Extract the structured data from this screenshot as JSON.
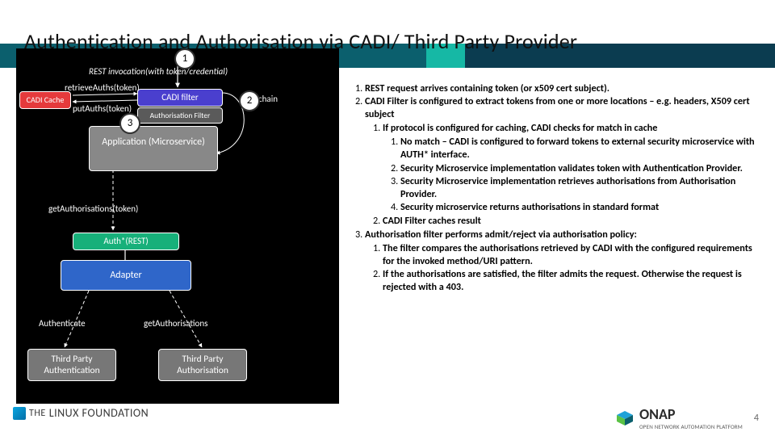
{
  "slide": {
    "title": "Authentication and Authorisation via CADI/ Third Party Provider",
    "page_number": "4"
  },
  "diagram": {
    "invocation": "REST invocation(with token/credential)",
    "retrieve_auths": "retrieveAuths(token)",
    "put_auths": "putAuths(token)",
    "cadi_cache": "CADI Cache",
    "cadi_filter": "CADI filter",
    "auth_filter": "Authorisation Filter",
    "chain": "chain",
    "app_ms": "Application (Microservice)",
    "get_auths": "getAuthorisations(token)",
    "auth_rest": "Auth*(REST)",
    "adapter": "Adapter",
    "authenticate": "Authenticate",
    "get_auths2": "getAuthorisations",
    "tp_authn": "Third Party Authentication",
    "tp_authz": "Third Party Authorisation"
  },
  "badges": {
    "b1": "1",
    "b2": "2",
    "b3": "3"
  },
  "steps": {
    "s1": "REST request arrives containing token (or x509 cert subject).",
    "s2_head": "CADI Filter is configured to extract tokens from one or more locations – e.g. headers, X509 cert subject",
    "s2_1_head": "If protocol is configured for caching, CADI checks for match in cache",
    "s2_1_1": "No match – CADI is configured to forward tokens to external security microservice with AUTH* interface.",
    "s2_1_2": "Security Microservice implementation validates token with Authentication Provider.",
    "s2_1_3": "Security Microservice implementation retrieves authorisations from Authorisation Provider.",
    "s2_1_4": "Security microservice returns authorisations in standard format",
    "s2_2": "CADI Filter caches result",
    "s3_head": "Authorisation filter performs admit/reject via authorisation policy:",
    "s3_1": "The filter compares the authorisations retrieved by CADI with the configured requirements for the invoked method/URI pattern.",
    "s3_2": "If the authorisations are satisfied, the filter admits the request. Otherwise the request is rejected with a 403."
  },
  "footer": {
    "linux_the": "THE",
    "linux_lf": "LINUX FOUNDATION",
    "onap_name": "ONAP",
    "onap_tag": "OPEN NETWORK AUTOMATION PLATFORM"
  },
  "colors": {
    "cadi_cache_bg": "#e53a3c",
    "cadi_filter_bg": "#4a3fce",
    "auth_filter_bg": "#5a5a5a",
    "app_bg": "#888",
    "auth_rest_bg": "#17b07a",
    "adapter_bg": "#2f66c9",
    "tp_bg": "#777"
  }
}
